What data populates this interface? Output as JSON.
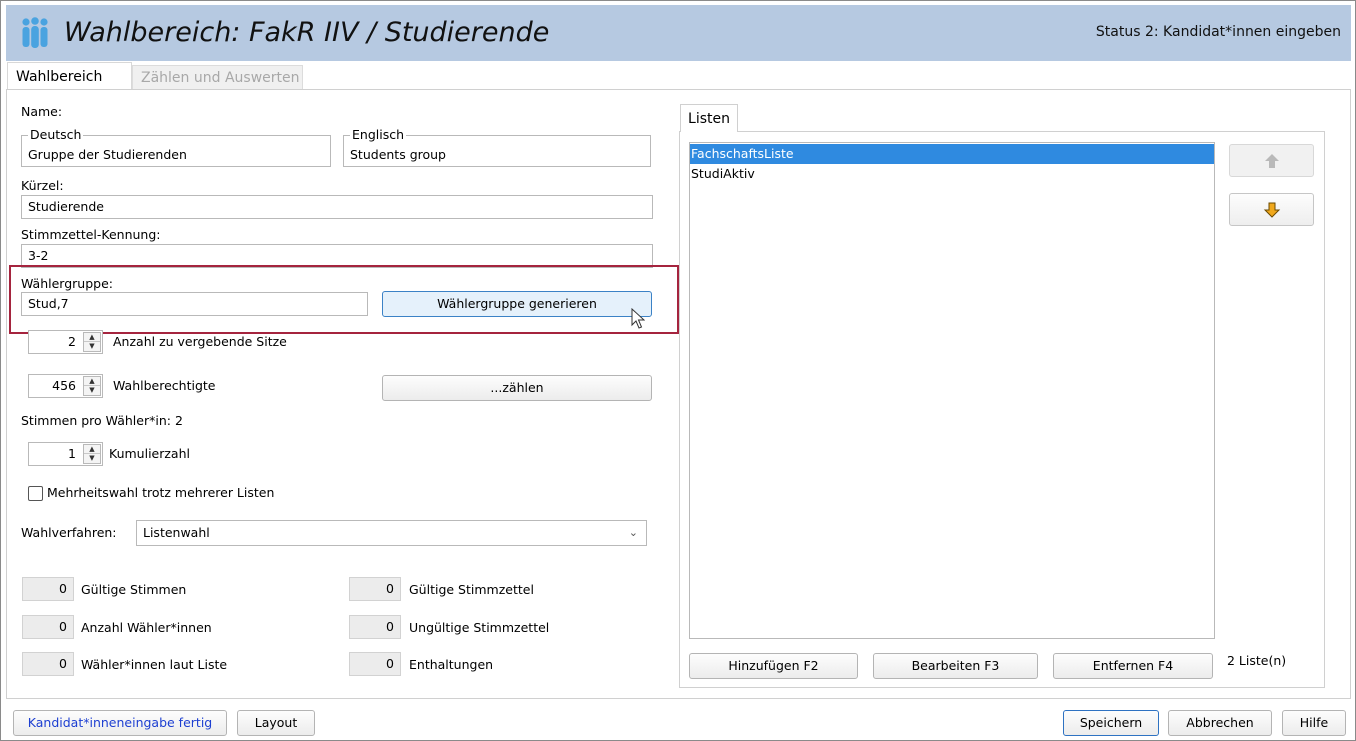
{
  "window": {
    "title": "Wahlbereich: FakR IIV / Studierende",
    "status": "Status 2: Kandidat*innen eingeben"
  },
  "tabs": {
    "wahlbereich": "Wahlbereich",
    "zaehlen": "Zählen und Auswerten"
  },
  "form": {
    "name_label": "Name:",
    "deutsch_legend": "Deutsch",
    "deutsch_value": "Gruppe der Studierenden",
    "englisch_legend": "Englisch",
    "englisch_value": "Students group",
    "kuerzel_label": "Kürzel:",
    "kuerzel_value": "Studierende",
    "stimmzettel_label": "Stimmzettel-Kennung:",
    "stimmzettel_value": "3-2",
    "waehlergruppe_label": "Wählergruppe:",
    "waehlergruppe_value": "Stud,7",
    "waehlergruppe_btn": "Wählergruppe generieren",
    "sitze_value": "2",
    "sitze_label": "Anzahl zu vergebende Sitze",
    "wahlberechtigte_value": "456",
    "wahlberechtigte_label": "Wahlberechtigte",
    "zaehlen_btn": "...zählen",
    "stimmen_pro_waehler": "Stimmen pro Wähler*in: 2",
    "kumulier_value": "1",
    "kumulier_label": "Kumulierzahl",
    "mehrheitswahl_label": "Mehrheitswahl trotz mehrerer Listen",
    "mehrheitswahl_checked": false,
    "wahlverfahren_label": "Wahlverfahren:",
    "wahlverfahren_value": "Listenwahl"
  },
  "stats": {
    "gueltige_stimmen_value": "0",
    "gueltige_stimmen_label": "Gültige Stimmen",
    "anzahl_waehler_value": "0",
    "anzahl_waehler_label": "Anzahl Wähler*innen",
    "waehler_liste_value": "0",
    "waehler_liste_label": "Wähler*innen laut Liste",
    "gueltige_zettel_value": "0",
    "gueltige_zettel_label": "Gültige Stimmzettel",
    "ungueltige_zettel_value": "0",
    "ungueltige_zettel_label": "Ungültige Stimmzettel",
    "enthaltungen_value": "0",
    "enthaltungen_label": "Enthaltungen"
  },
  "listen": {
    "tab_label": "Listen",
    "items": [
      "FachschaftsListe",
      "StudiAktiv"
    ],
    "selected_index": 0,
    "hinzufuegen": "Hinzufügen F2",
    "bearbeiten": "Bearbeiten F3",
    "entfernen": "Entfernen F4",
    "count": "2 Liste(n)",
    "up_icon": "arrow-up-icon",
    "down_icon": "arrow-down-icon"
  },
  "footer": {
    "kandidat_fertig": "Kandidat*inneneingabe fertig",
    "layout": "Layout",
    "speichern": "Speichern",
    "abbrechen": "Abbrechen",
    "hilfe": "Hilfe"
  },
  "colors": {
    "titlebar": "#b6c9e1",
    "selection": "#2f8ae0",
    "highlight_frame": "#a5243e",
    "link_button_text": "#1d3fd1",
    "arrow_down": "#f0a81c"
  }
}
